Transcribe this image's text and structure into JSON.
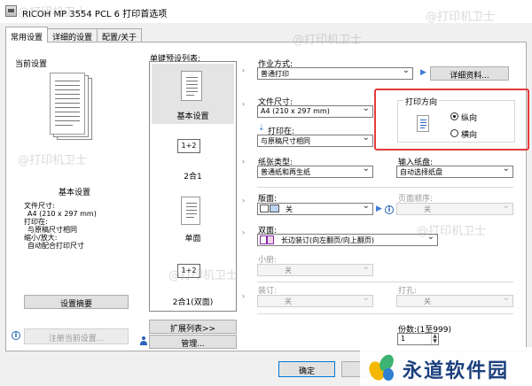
{
  "window": {
    "title": "RICOH MP 3554 PCL 6 打印首选项"
  },
  "tabs": [
    {
      "label": "常用设置"
    },
    {
      "label": "详细的设置"
    },
    {
      "label": "配置/关于"
    }
  ],
  "current_settings": {
    "header": "当前设置",
    "name": "基本设置",
    "details": [
      "文件尺寸:",
      "A4 (210 x 297 mm)",
      "打印在:",
      "与原稿尺寸相同",
      "缩小/放大:",
      "自动配合打印尺寸"
    ],
    "summary_button": "设置摘要",
    "register_button": "注册当前设置..."
  },
  "presets": {
    "header": "单键预设列表:",
    "items": [
      {
        "label": "基本设置",
        "icon": "page-icon"
      },
      {
        "label": "2合1",
        "icon": "two-in-one-icon",
        "glyph": "1+2"
      },
      {
        "label": "单面",
        "icon": "page-icon"
      },
      {
        "label": "2合1(双面)",
        "icon": "two-in-one-icon",
        "glyph": "1+2"
      }
    ],
    "extend_button": "扩展列表>>",
    "manage_button": "管理..."
  },
  "job": {
    "type_label": "作业方式:",
    "type_value": "普通打印",
    "details_button": "详细资料..."
  },
  "paper": {
    "size_label": "文件尺寸:",
    "size_value": "A4 (210 x 297 mm)",
    "print_on_label": "打印在:",
    "print_on_value": "与原稿尺寸相同",
    "type_label": "纸张类型:",
    "type_value": "普通纸和再生纸",
    "tray_label": "输入纸盘:",
    "tray_value": "自动选择纸盘"
  },
  "orientation": {
    "label": "打印方向",
    "portrait": "纵向",
    "landscape": "横向",
    "selected": "portrait",
    "highlight_color": "#e63a3a"
  },
  "layout": {
    "pages_label": "版面:",
    "pages_value": "关",
    "page_order_label": "页面顺序:",
    "page_order_value": "关",
    "duplex_label": "双面:",
    "duplex_value": "长边装订(向左翻页/向上翻页)",
    "booklet_label": "小册:",
    "booklet_value": "关",
    "staple_label": "装订:",
    "staple_value": "关",
    "punch_label": "打孔:",
    "punch_value": "关",
    "copies_label": "份数:(1至999)",
    "copies_value": "1"
  },
  "footer": {
    "ok_button": "确定"
  },
  "watermarks": [
    "@打印机卫士"
  ],
  "brand": {
    "name": "永道软件园"
  }
}
